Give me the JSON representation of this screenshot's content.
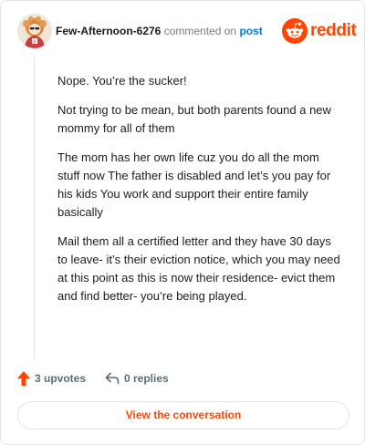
{
  "comment": {
    "username": "Few-Afternoon-6276",
    "action_text": "commented on",
    "post_link": "post",
    "paragraphs": [
      "Nope. You’re the sucker!",
      "Not trying to be mean, but both parents found a new mommy for all of them",
      "The mom has her own life cuz you do all the mom stuff now The father is disabled and let’s you pay for his kids You work and support their entire family basically",
      "Mail them all a certified letter and they have 30 days to leave- it’s their eviction notice, which you may need at this point as this is now their residence- evict them and find better- you’re being played."
    ]
  },
  "brand": {
    "wordmark": "reddit",
    "color": "#ff4500"
  },
  "actions": {
    "upvotes": "3 upvotes",
    "replies": "0 replies"
  },
  "cta": {
    "label": "View the conversation"
  }
}
